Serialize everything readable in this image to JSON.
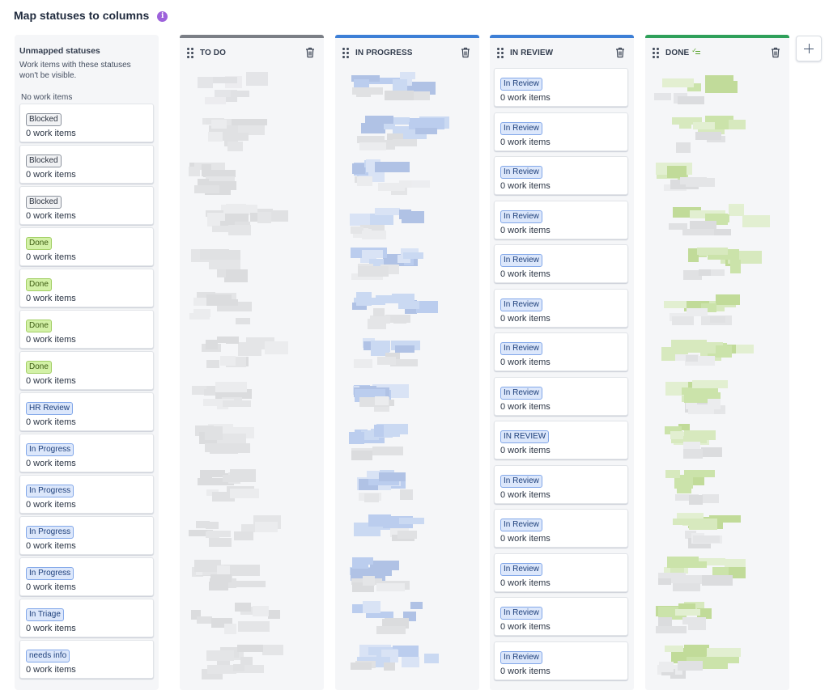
{
  "header": {
    "title": "Map statuses to columns",
    "info_icon": "info-icon"
  },
  "unmapped": {
    "title": "Unmapped statuses",
    "description": "Work items with these statuses won't be visible.",
    "no_items": "No work items",
    "items": [
      {
        "status": "Blocked",
        "color": "gray",
        "count": "0 work items"
      },
      {
        "status": "Blocked",
        "color": "gray",
        "count": "0 work items"
      },
      {
        "status": "Blocked",
        "color": "gray",
        "count": "0 work items"
      },
      {
        "status": "Done",
        "color": "green",
        "count": "0 work items"
      },
      {
        "status": "Done",
        "color": "green",
        "count": "0 work items"
      },
      {
        "status": "Done",
        "color": "green",
        "count": "0 work items"
      },
      {
        "status": "Done",
        "color": "green",
        "count": "0 work items"
      },
      {
        "status": "HR Review",
        "color": "blue",
        "count": "0 work items"
      },
      {
        "status": "In Progress",
        "color": "blue",
        "count": "0 work items"
      },
      {
        "status": "In Progress",
        "color": "blue",
        "count": "0 work items"
      },
      {
        "status": "In Progress",
        "color": "blue",
        "count": "0 work items"
      },
      {
        "status": "In Progress",
        "color": "blue",
        "count": "0 work items"
      },
      {
        "status": "In Triage",
        "color": "blue",
        "count": "0 work items"
      },
      {
        "status": "needs info",
        "color": "blue",
        "count": "0 work items"
      }
    ]
  },
  "columns": [
    {
      "name": "TO DO",
      "accent": "#7b7f86",
      "tint": "gray",
      "done_icon": false,
      "blurred": 14
    },
    {
      "name": "IN PROGRESS",
      "accent": "#3d7fd6",
      "tint": "blue",
      "done_icon": false,
      "blurred": 14
    },
    {
      "name": "IN REVIEW",
      "accent": "#3d7fd6",
      "tint": "blue",
      "done_icon": false,
      "blurred": 0,
      "items": [
        {
          "status": "In Review",
          "count": "0 work items"
        },
        {
          "status": "In Review",
          "count": "0 work items"
        },
        {
          "status": "In Review",
          "count": "0 work items"
        },
        {
          "status": "In Review",
          "count": "0 work items"
        },
        {
          "status": "In Review",
          "count": "0 work items"
        },
        {
          "status": "In Review",
          "count": "0 work items"
        },
        {
          "status": "In Review",
          "count": "0 work items"
        },
        {
          "status": "In Review",
          "count": "0 work items"
        },
        {
          "status": "IN REVIEW",
          "count": "0 work items"
        },
        {
          "status": "In Review",
          "count": "0 work items"
        },
        {
          "status": "In Review",
          "count": "0 work items"
        },
        {
          "status": "In Review",
          "count": "0 work items"
        },
        {
          "status": "In Review",
          "count": "0 work items"
        },
        {
          "status": "In Review",
          "count": "0 work items"
        }
      ]
    },
    {
      "name": "DONE",
      "accent": "#2fa05a",
      "tint": "green",
      "done_icon": true,
      "blurred": 14
    }
  ],
  "icons": {
    "drag": "drag-handle-icon",
    "delete": "trash-icon",
    "add": "plus-icon",
    "done": "checklist-icon"
  },
  "colors": {
    "gray_lozenge": "#f1f2f4",
    "green_lozenge": "#d3f1a7",
    "blue_lozenge": "#dce7fb",
    "column_bg": "#f5f6f8"
  }
}
